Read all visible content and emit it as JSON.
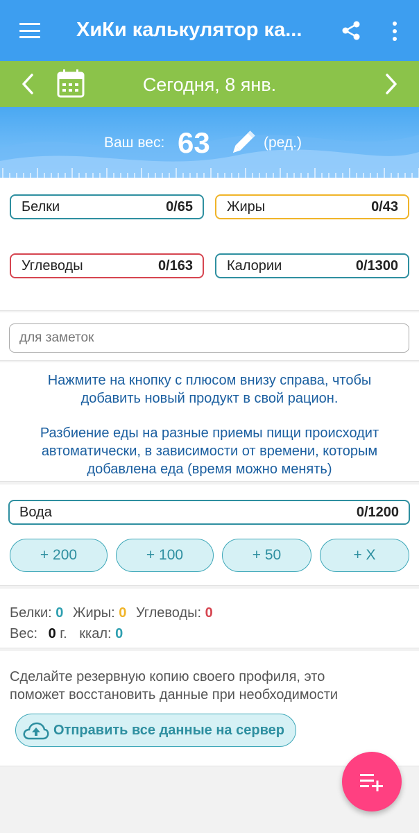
{
  "appbar": {
    "title": "ХиКи калькулятор ка..."
  },
  "datebar": {
    "date": "Сегодня, 8 янв."
  },
  "weight": {
    "label": "Ваш вес:",
    "value": "63",
    "edit": "(ред.)"
  },
  "macros": {
    "protein": {
      "label": "Белки",
      "value": "0/65"
    },
    "fat": {
      "label": "Жиры",
      "value": "0/43"
    },
    "carbs": {
      "label": "Углеводы",
      "value": "0/163"
    },
    "calories": {
      "label": "Калории",
      "value": "0/1300"
    }
  },
  "notes": {
    "placeholder": "для заметок"
  },
  "hint": {
    "line1": "Нажмите на кнопку с плюсом внизу справа, чтобы",
    "line2": "добавить новый продукт в свой рацион.",
    "line3": "Разбиение еды на разные приемы пищи происходит",
    "line4": "автоматически, в зависимости от времени, которым",
    "line5": "добавлена еда (время можно менять)"
  },
  "water": {
    "label": "Вода",
    "value": "0/1200",
    "buttons": [
      "+ 200",
      "+ 100",
      "+ 50",
      "+ X"
    ]
  },
  "totals": {
    "protein_label": "Белки:",
    "protein": "0",
    "fat_label": "Жиры:",
    "fat": "0",
    "carbs_label": "Углеводы:",
    "carbs": "0",
    "weight_label": "Вес:",
    "weight": "0",
    "weight_unit": "г.",
    "kcal_label": "ккал:",
    "kcal": "0"
  },
  "backup": {
    "line1": "Сделайте резервную копию своего профиля, это",
    "line2": "поможет восстановить данные при необходимости",
    "button": "Отправить все данные на сервер"
  },
  "colors": {
    "appbar": "#3d9ef0",
    "datebar": "#8bc34a",
    "fab": "#ff4081",
    "protein": "#2e8fa0",
    "fat": "#f0b429",
    "carbs": "#d64550"
  },
  "icons": [
    "menu-icon",
    "share-icon",
    "more-icon",
    "chevron-left-icon",
    "calendar-icon",
    "chevron-right-icon",
    "pencil-icon",
    "cloud-upload-icon",
    "playlist-add-icon"
  ]
}
